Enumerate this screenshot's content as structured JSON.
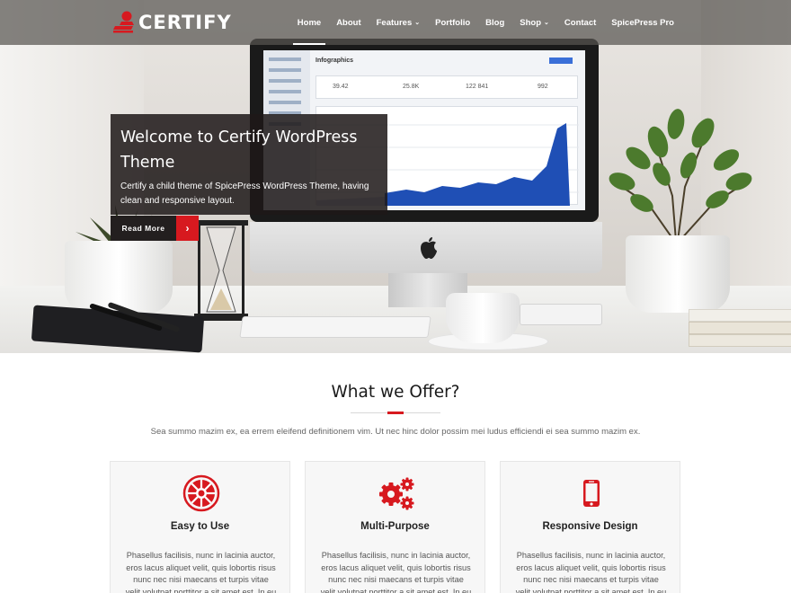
{
  "brand": {
    "name": "CERTIFY",
    "accent": "#d7191f"
  },
  "nav": {
    "items": [
      {
        "label": "Home",
        "caret": false,
        "active": true
      },
      {
        "label": "About",
        "caret": false
      },
      {
        "label": "Features",
        "caret": true
      },
      {
        "label": "Portfolio",
        "caret": false
      },
      {
        "label": "Blog",
        "caret": false
      },
      {
        "label": "Shop",
        "caret": true
      },
      {
        "label": "Contact",
        "caret": false
      },
      {
        "label": "SpicePress Pro",
        "caret": false
      }
    ]
  },
  "hero": {
    "title": "Welcome to Certify WordPress Theme",
    "text": "Certify a child theme of SpicePress WordPress Theme, having clean and responsive layout.",
    "button_label": "Read More",
    "button_icon": "chevron-right-icon",
    "screen": {
      "heading": "Infographics",
      "stats": [
        "39.42",
        "25.8K",
        "122 841",
        "992"
      ]
    }
  },
  "offer": {
    "title": "What we Offer?",
    "subtitle": "Sea summo mazim ex, ea errem eleifend definitionem vim. Ut nec hinc dolor possim mei ludus efficiendi ei sea summo mazim ex.",
    "cards": [
      {
        "icon": "empire-icon",
        "title": "Easy to Use",
        "text": "Phasellus facilisis, nunc in lacinia auctor, eros lacus aliquet velit, quis lobortis risus nunc nec nisi maecans et turpis vitae velit.volutpat porttitor a sit amet est. In eu rutrum ante."
      },
      {
        "icon": "gears-icon",
        "title": "Multi-Purpose",
        "text": "Phasellus facilisis, nunc in lacinia auctor, eros lacus aliquet velit, quis lobortis risus nunc nec nisi maecans et turpis vitae velit.volutpat porttitor a sit amet est. In eu rutrum ante."
      },
      {
        "icon": "mobile-phone-icon",
        "title": "Responsive Design",
        "text": "Phasellus facilisis, nunc in lacinia auctor, eros lacus aliquet velit, quis lobortis risus nunc nec nisi maecans et turpis vitae velit.volutpat porttitor a sit amet est. In eu rutrum ante."
      }
    ]
  }
}
